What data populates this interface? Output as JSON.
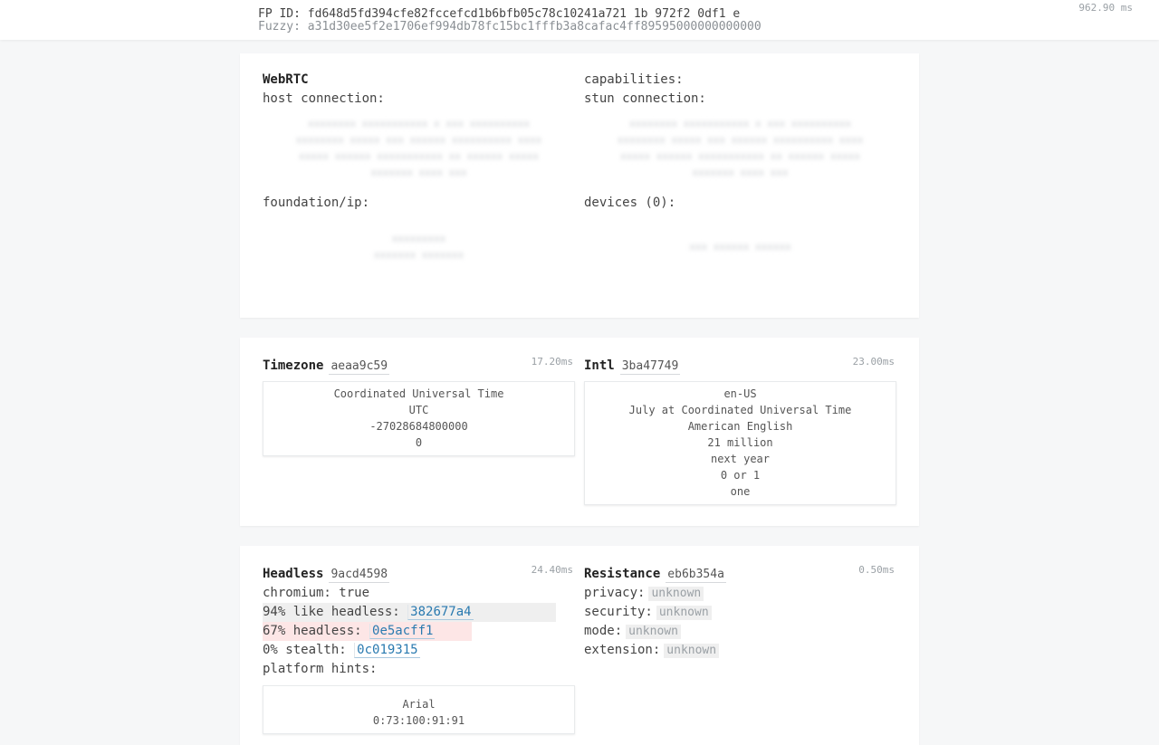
{
  "header": {
    "fp_id": "FP ID: fd648d5fd394cfe82fccefcd1b6bfb05c78c10241a721 1b 972f2 0df1 e",
    "fuzzy": "Fuzzy: a31d30ee5f2e1706ef994db78fc15bc1fffb3a8cafac4ff89595000000000000",
    "timing": "962.90 ms"
  },
  "webrtc": {
    "title": "WebRTC",
    "capabilities_label": "capabilities:",
    "host_label": "host connection:",
    "stun_label": "stun connection:",
    "foundation_label": "foundation/ip:",
    "devices_label": "devices (0):"
  },
  "timezone": {
    "title": "Timezone",
    "hash": "aeaa9c59",
    "ms": "17.20ms",
    "lines": [
      "Coordinated Universal Time",
      "UTC",
      "-27028684800000",
      "0"
    ]
  },
  "intl": {
    "title": "Intl",
    "hash": "3ba47749",
    "ms": "23.00ms",
    "lines": [
      "en-US",
      "July at Coordinated Universal Time",
      "American English",
      "21 million",
      "next year",
      "0 or 1",
      "one"
    ]
  },
  "headless": {
    "title": "Headless",
    "hash": "9acd4598",
    "ms": "24.40ms",
    "chromium": "chromium: true",
    "like_headless_label": "94% like headless:",
    "like_headless_hash": "382677a4",
    "headless_label": "67% headless:",
    "headless_hash": "0e5acff1",
    "stealth_label": "0% stealth:",
    "stealth_hash": "0c019315",
    "platform_hints_label": "platform hints:",
    "hints_lines": [
      "Arial",
      "0:73:100:91:91"
    ]
  },
  "resistance": {
    "title": "Resistance",
    "hash": "eb6b354a",
    "ms": "0.50ms",
    "privacy_label": "privacy:",
    "privacy_value": "unknown",
    "security_label": "security:",
    "security_value": "unknown",
    "mode_label": "mode:",
    "mode_value": "unknown",
    "extension_label": "extension:",
    "extension_value": "unknown"
  },
  "colors": {
    "link": "#2a7ab0",
    "highlight_grey": "#efefef",
    "highlight_red": "#fde6e6"
  }
}
